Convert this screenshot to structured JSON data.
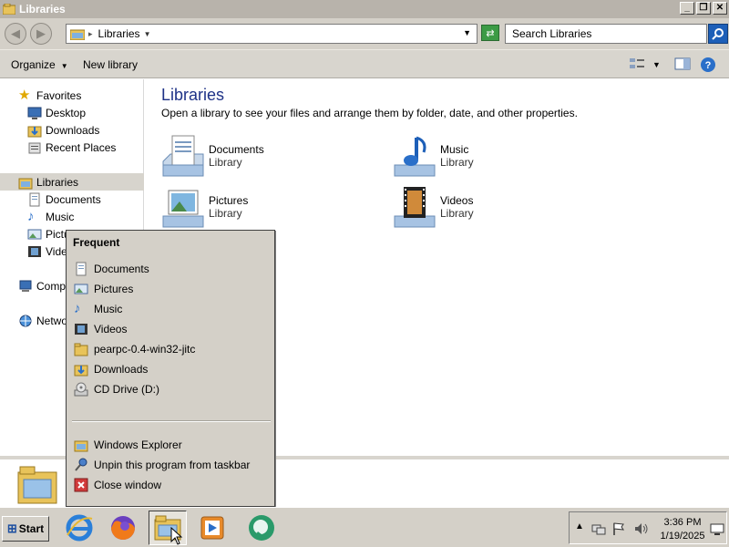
{
  "window": {
    "title": "Libraries",
    "controls": {
      "minimize": "_",
      "maximize": "❐",
      "close": "✕"
    }
  },
  "address": {
    "crumb": "Libraries",
    "search_placeholder": "Search Libraries"
  },
  "toolbar": {
    "organize_label": "Organize",
    "new_library_label": "New library"
  },
  "nav": {
    "favorites": "Favorites",
    "desktop": "Desktop",
    "downloads": "Downloads",
    "recent_places": "Recent Places",
    "libraries": "Libraries",
    "documents": "Documents",
    "music": "Music",
    "pictures": "Pictu",
    "videos": "Video",
    "computer": "Compu",
    "network": "Netwo"
  },
  "content": {
    "title": "Libraries",
    "subtitle": "Open a library to see your files and arrange them by folder, date, and other properties.",
    "libraries": [
      {
        "name": "Documents",
        "type": "Library",
        "icon": "documents-library-icon"
      },
      {
        "name": "Music",
        "type": "Library",
        "icon": "music-library-icon"
      },
      {
        "name": "Pictures",
        "type": "Library",
        "icon": "pictures-library-icon"
      },
      {
        "name": "Videos",
        "type": "Library",
        "icon": "videos-library-icon"
      }
    ]
  },
  "jumplist": {
    "header": "Frequent",
    "frequent": [
      {
        "label": "Documents",
        "icon": "documents-icon"
      },
      {
        "label": "Pictures",
        "icon": "pictures-icon"
      },
      {
        "label": "Music",
        "icon": "music-icon"
      },
      {
        "label": "Videos",
        "icon": "videos-icon"
      },
      {
        "label": "pearpc-0.4-win32-jitc",
        "icon": "folder-icon"
      },
      {
        "label": "Downloads",
        "icon": "downloads-icon"
      },
      {
        "label": "CD Drive (D:)",
        "icon": "cd-drive-icon"
      }
    ],
    "tasks": [
      {
        "label": "Windows Explorer",
        "icon": "explorer-icon"
      },
      {
        "label": "Unpin this program from taskbar",
        "icon": "unpin-icon"
      },
      {
        "label": "Close window",
        "icon": "close-window-icon"
      }
    ]
  },
  "taskbar": {
    "start_label": "Start",
    "apps": [
      "internet-explorer-icon",
      "firefox-icon",
      "windows-explorer-icon",
      "media-player-icon",
      "messenger-icon"
    ]
  },
  "clock": {
    "time": "3:36 PM",
    "date": "1/19/2025"
  },
  "colors": {
    "chrome": "#d4d0c8",
    "title_bar": "#b8b3ab",
    "heading_blue": "#1e3287",
    "search_button": "#1d5fb8"
  }
}
